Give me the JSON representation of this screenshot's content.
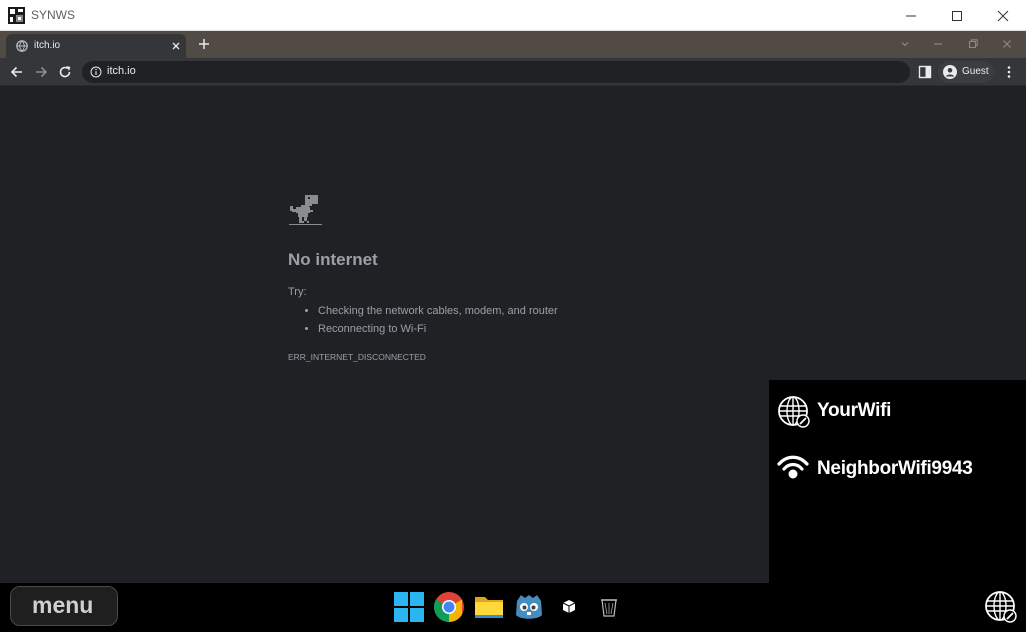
{
  "window": {
    "title": "SYNWS"
  },
  "browser": {
    "tab": {
      "title": "itch.io"
    },
    "url": "itch.io",
    "profile": "Guest"
  },
  "error_page": {
    "title": "No internet",
    "try_label": "Try:",
    "suggestions": [
      "Checking the network cables, modem, and router",
      "Reconnecting to Wi-Fi"
    ],
    "code": "ERR_INTERNET_DISCONNECTED"
  },
  "wifi_panel": {
    "networks": [
      {
        "name": "YourWifi",
        "icon": "globe-icon"
      },
      {
        "name": "NeighborWifi9943",
        "icon": "wifi-icon"
      }
    ]
  },
  "taskbar": {
    "menu_label": "menu",
    "apps": [
      "start-icon",
      "chrome-icon",
      "file-explorer-icon",
      "godot-icon",
      "cube-icon",
      "recycle-bin-icon"
    ],
    "tray": "network-globe-icon"
  },
  "colors": {
    "page_bg": "#202124",
    "toolbar_bg": "#35363a",
    "tabstrip_bg": "#524a45",
    "error_text": "#9aa0a6"
  }
}
